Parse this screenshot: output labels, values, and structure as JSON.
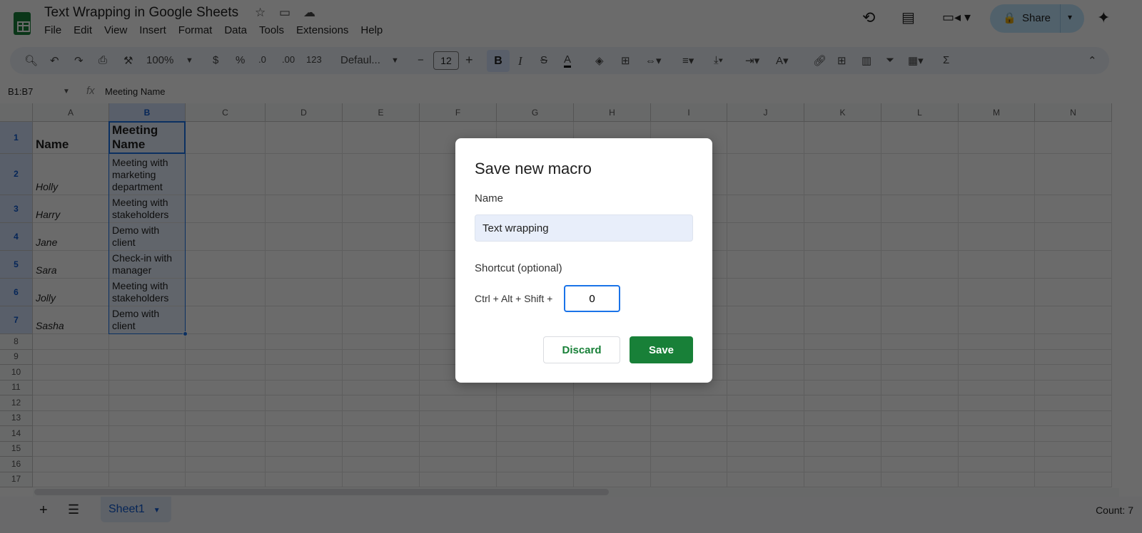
{
  "doc": {
    "title": "Text Wrapping in Google Sheets"
  },
  "menu": [
    "File",
    "Edit",
    "View",
    "Insert",
    "Format",
    "Data",
    "Tools",
    "Extensions",
    "Help"
  ],
  "toolbar": {
    "zoom": "100%",
    "currency": "$",
    "percent": "%",
    "dec_decrease": ".0",
    "dec_increase": ".00",
    "number_format": "123",
    "font": "Defaul...",
    "font_size": "12",
    "bold": "B",
    "italic": "I",
    "sum": "Σ"
  },
  "header": {
    "share_label": "Share"
  },
  "formula_bar": {
    "name_box": "B1:B7",
    "fx": "fx",
    "content": "Meeting Name"
  },
  "columns": [
    "A",
    "B",
    "C",
    "D",
    "E",
    "F",
    "G",
    "H",
    "I",
    "J",
    "K",
    "L",
    "M",
    "N"
  ],
  "rows": [
    {
      "num": "1",
      "a": "Name",
      "b": "Meeting Name"
    },
    {
      "num": "2",
      "a": "Holly",
      "b": "Meeting with marketing department"
    },
    {
      "num": "3",
      "a": "Harry",
      "b": "Meeting with stakeholders"
    },
    {
      "num": "4",
      "a": "Jane",
      "b": "Demo with client"
    },
    {
      "num": "5",
      "a": "Sara",
      "b": "Check-in with manager"
    },
    {
      "num": "6",
      "a": "Jolly",
      "b": "Meeting with stakeholders"
    },
    {
      "num": "7",
      "a": "Sasha",
      "b": "Demo with client"
    },
    {
      "num": "8"
    },
    {
      "num": "9"
    },
    {
      "num": "10"
    },
    {
      "num": "11"
    },
    {
      "num": "12"
    },
    {
      "num": "13"
    },
    {
      "num": "14"
    },
    {
      "num": "15"
    },
    {
      "num": "16"
    },
    {
      "num": "17"
    }
  ],
  "sheets": [
    {
      "name": "Sheet1"
    }
  ],
  "status": {
    "count": "Count: 7"
  },
  "dialog": {
    "title": "Save new macro",
    "name_label": "Name",
    "name_value": "Text wrapping",
    "shortcut_label": "Shortcut (optional)",
    "shortcut_prefix": "Ctrl + Alt + Shift +",
    "shortcut_value": "0",
    "discard": "Discard",
    "save": "Save"
  },
  "colors": {
    "accent": "#188038",
    "selection": "#1a73e8"
  }
}
